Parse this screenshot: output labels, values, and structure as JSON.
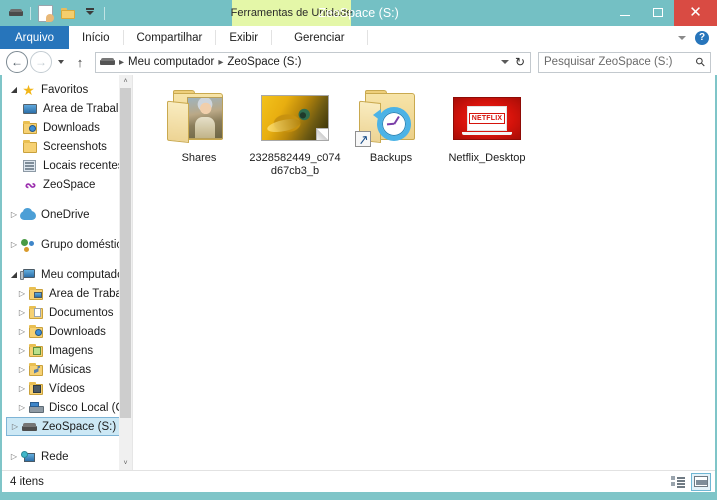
{
  "window": {
    "title": "ZeoSpace (S:)",
    "frame_color": "#74c0c4",
    "accent_color": "#2775bb"
  },
  "quick_access_toolbar": {
    "items": [
      {
        "name": "drive-icon",
        "label": "Propriedades da unidade"
      },
      {
        "name": "properties-icon",
        "label": "Propriedades"
      },
      {
        "name": "new-folder-icon",
        "label": "Nova pasta"
      },
      {
        "name": "customize-chevron",
        "label": "Personalizar Barra de Ferramentas de Acesso Rápido"
      }
    ]
  },
  "caption": {
    "minimize": "–",
    "maximize": "□",
    "close": "✕"
  },
  "contextual_tab_header": "Ferramentas de Unidade",
  "ribbon": {
    "tabs": [
      {
        "label": "Arquivo",
        "active": true
      },
      {
        "label": "Início",
        "active": false
      },
      {
        "label": "Compartilhar",
        "active": false
      },
      {
        "label": "Exibir",
        "active": false
      },
      {
        "label": "Gerenciar",
        "active": false
      }
    ],
    "collapse_label": "Minimizar a Faixa de Opções",
    "help_label": "?"
  },
  "address_bar": {
    "back": "←",
    "forward": "→",
    "recent_label": "Locais recentes",
    "up": "↑",
    "breadcrumbs": [
      "Meu computador",
      "ZeoSpace (S:)"
    ],
    "separator": "▸",
    "refresh": "↻"
  },
  "search": {
    "placeholder": "Pesquisar ZeoSpace (S:)",
    "value": "",
    "icon": "⚲"
  },
  "sidebar": {
    "groups": [
      {
        "label": "Favoritos",
        "icon": "star-icon",
        "expanded": true,
        "twisty": "◢",
        "items": [
          {
            "label": "Área de Trabalho",
            "icon": "desktop-icon",
            "twisty": ""
          },
          {
            "label": "Downloads",
            "icon": "downloads-folder-icon",
            "twisty": ""
          },
          {
            "label": "Screenshots",
            "icon": "folder-icon",
            "twisty": ""
          },
          {
            "label": "Locais recentes",
            "icon": "recent-places-icon",
            "twisty": ""
          },
          {
            "label": "ZeoSpace",
            "icon": "zeospace-icon",
            "twisty": ""
          }
        ]
      },
      {
        "label": "OneDrive",
        "icon": "cloud-icon",
        "expanded": false,
        "twisty": "▷",
        "items": []
      },
      {
        "label": "Grupo doméstico",
        "icon": "homegroup-icon",
        "expanded": false,
        "twisty": "▷",
        "items": []
      },
      {
        "label": "Meu computador",
        "icon": "computer-icon",
        "expanded": true,
        "twisty": "◢",
        "items": [
          {
            "label": "Área de Trabalho",
            "icon": "desktop-folder-icon",
            "twisty": "▷"
          },
          {
            "label": "Documentos",
            "icon": "documents-folder-icon",
            "twisty": "▷"
          },
          {
            "label": "Downloads",
            "icon": "downloads-folder-icon",
            "twisty": "▷"
          },
          {
            "label": "Imagens",
            "icon": "pictures-folder-icon",
            "twisty": "▷"
          },
          {
            "label": "Músicas",
            "icon": "music-folder-icon",
            "twisty": "▷"
          },
          {
            "label": "Vídeos",
            "icon": "videos-folder-icon",
            "twisty": "▷"
          },
          {
            "label": "Disco Local (C:)",
            "icon": "hard-disk-icon",
            "twisty": "▷"
          },
          {
            "label": "ZeoSpace (S:)",
            "icon": "drive-icon",
            "twisty": "▷",
            "selected": true
          }
        ]
      },
      {
        "label": "Rede",
        "icon": "network-icon",
        "expanded": false,
        "twisty": "▷",
        "items": []
      }
    ],
    "scroll_up": "˄",
    "scroll_down": "˅"
  },
  "files": [
    {
      "name": "Shares",
      "type": "folder-with-preview"
    },
    {
      "name": "2328582449_c074d67cb3_b",
      "type": "image-file"
    },
    {
      "name": "Backups",
      "type": "folder-shortcut-history"
    },
    {
      "name": "Netflix_Desktop",
      "type": "app-shortcut"
    }
  ],
  "status": {
    "item_count": "4 itens",
    "views": [
      {
        "name": "details-view",
        "label": "Exibir detalhes",
        "active": false
      },
      {
        "name": "large-icons-view",
        "label": "Exibir ícones grandes",
        "active": true
      }
    ]
  }
}
